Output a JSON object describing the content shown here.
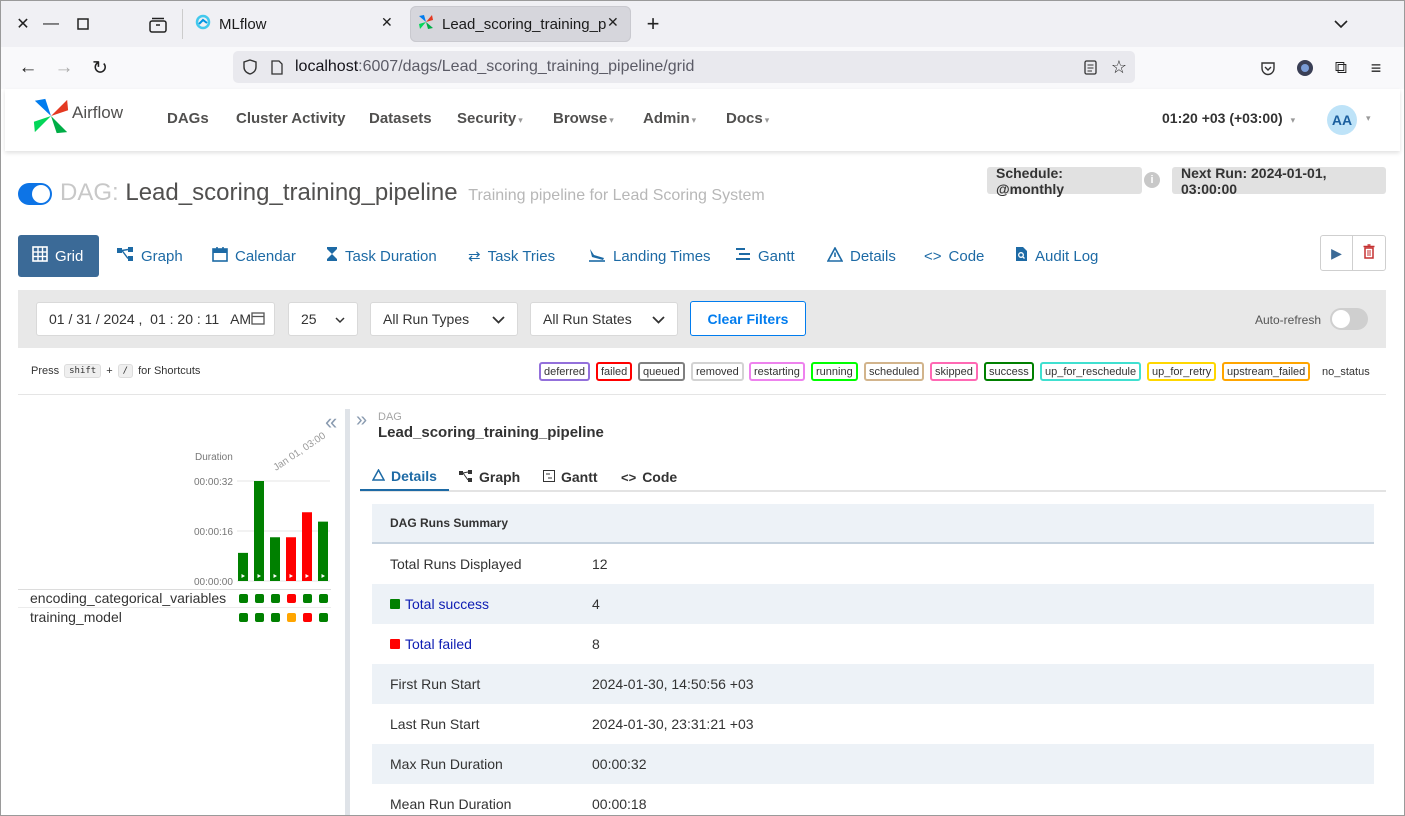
{
  "browser": {
    "tabs": [
      {
        "title": "MLflow"
      },
      {
        "title": "Lead_scoring_training_pipeline"
      }
    ],
    "url_host": "localhost",
    "url_rest": ":6007/dags/Lead_scoring_training_pipeline/grid"
  },
  "airflow": {
    "brand": "Airflow",
    "menu": [
      "DAGs",
      "Cluster Activity",
      "Datasets",
      "Security",
      "Browse",
      "Admin",
      "Docs"
    ],
    "clock": "01:20 +03 (+03:00)",
    "avatar": "AA"
  },
  "dag": {
    "prefix": "DAG:",
    "name": "Lead_scoring_training_pipeline",
    "description": "Training pipeline for Lead Scoring System",
    "schedule": "Schedule: @monthly",
    "next_run": "Next Run: 2024-01-01, 03:00:00"
  },
  "view_tabs": [
    "Grid",
    "Graph",
    "Calendar",
    "Task Duration",
    "Task Tries",
    "Landing Times",
    "Gantt",
    "Details",
    "Code",
    "Audit Log"
  ],
  "filters": {
    "datetime": "01 / 31 / 2024 ,  01 : 20 : 11   AM",
    "num_runs": "25",
    "run_types": "All Run Types",
    "run_states": "All Run States",
    "clear": "Clear Filters",
    "auto_refresh": "Auto-refresh"
  },
  "shortcuts": {
    "press": "Press",
    "key1": "shift",
    "plus": "+",
    "key2": "/",
    "suffix": "for Shortcuts"
  },
  "legend": [
    {
      "label": "deferred",
      "color": "#9370db"
    },
    {
      "label": "failed",
      "color": "#ff0000"
    },
    {
      "label": "queued",
      "color": "#808080"
    },
    {
      "label": "removed",
      "color": "#d3d3d3"
    },
    {
      "label": "restarting",
      "color": "#ee82ee"
    },
    {
      "label": "running",
      "color": "#00ff00"
    },
    {
      "label": "scheduled",
      "color": "#d2b48c"
    },
    {
      "label": "skipped",
      "color": "#ff69b4"
    },
    {
      "label": "success",
      "color": "#008000"
    },
    {
      "label": "up_for_reschedule",
      "color": "#40e0d0"
    },
    {
      "label": "up_for_retry",
      "color": "#ffd700"
    },
    {
      "label": "upstream_failed",
      "color": "#ffa500"
    },
    {
      "label": "no_status",
      "color": "#ffffff"
    }
  ],
  "grid": {
    "duration_label": "Duration",
    "date_label": "Jan 01, 03:00",
    "ticks": [
      "00:00:32",
      "00:00:16",
      "00:00:00"
    ],
    "tasks": [
      {
        "name": "encoding_categorical_variables",
        "states": [
          "success",
          "success",
          "success",
          "failed",
          "success",
          "success"
        ]
      },
      {
        "name": "training_model",
        "states": [
          "success",
          "success",
          "success",
          "up_for_retry",
          "failed",
          "success"
        ]
      }
    ]
  },
  "chart_data": {
    "type": "bar",
    "title": "",
    "ylabel": "Duration",
    "yticks": [
      "00:00:32",
      "00:00:16",
      "00:00:00"
    ],
    "ylim": [
      0,
      34
    ],
    "values": [
      9,
      32,
      14,
      14,
      22,
      19
    ],
    "states": [
      "success",
      "success",
      "success",
      "failed",
      "failed",
      "success"
    ]
  },
  "details": {
    "label": "DAG",
    "name": "Lead_scoring_training_pipeline",
    "tabs": [
      "Details",
      "Graph",
      "Gantt",
      "Code"
    ],
    "summary_title": "DAG Runs Summary",
    "rows": [
      {
        "k": "Total Runs Displayed",
        "v": "12"
      },
      {
        "k": "Total success",
        "v": "4"
      },
      {
        "k": "Total failed",
        "v": "8"
      },
      {
        "k": "First Run Start",
        "v": "2024-01-30, 14:50:56 +03"
      },
      {
        "k": "Last Run Start",
        "v": "2024-01-30, 23:31:21 +03"
      },
      {
        "k": "Max Run Duration",
        "v": "00:00:32"
      },
      {
        "k": "Mean Run Duration",
        "v": "00:00:18"
      }
    ]
  },
  "colors": {
    "success": "#008000",
    "failed": "#ff0000",
    "up_for_retry": "#ffa500"
  }
}
